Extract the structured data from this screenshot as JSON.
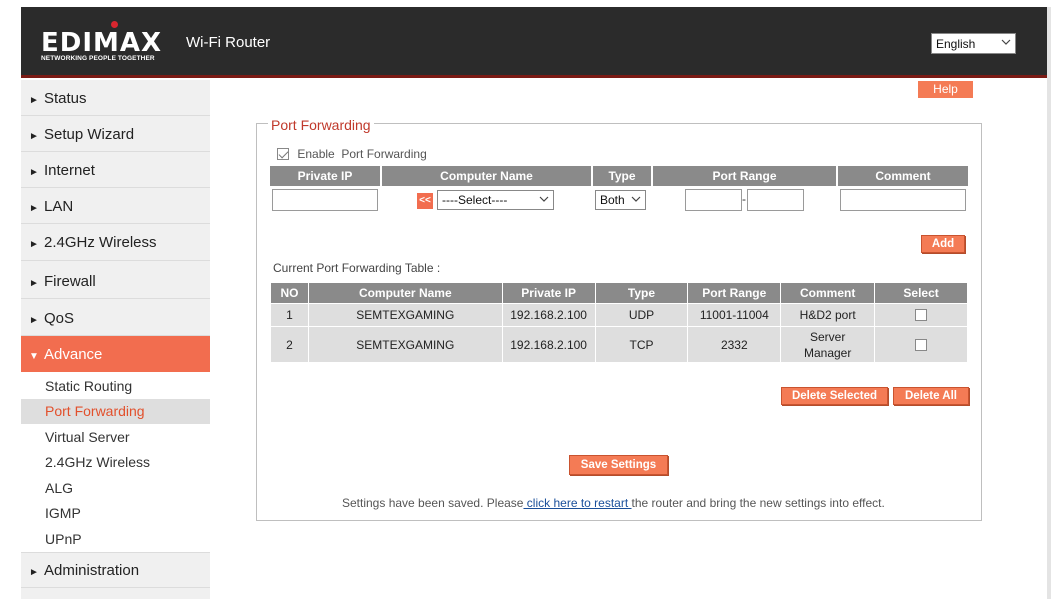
{
  "header": {
    "logo_text": "EDIMAX",
    "logo_tagline": "NETWORKING PEOPLE TOGETHER",
    "app_title": "Wi-Fi Router",
    "language": "English"
  },
  "sidebar": {
    "items": [
      {
        "label": "Status"
      },
      {
        "label": "Setup Wizard"
      },
      {
        "label": "Internet"
      },
      {
        "label": "LAN"
      },
      {
        "label": "2.4GHz Wireless"
      },
      {
        "label": "Firewall"
      },
      {
        "label": "QoS"
      },
      {
        "label": "Advance"
      },
      {
        "label": "Administration"
      }
    ],
    "advance_sub": [
      {
        "label": "Static Routing"
      },
      {
        "label": "Port Forwarding"
      },
      {
        "label": "Virtual Server"
      },
      {
        "label": "2.4GHz Wireless"
      },
      {
        "label": "ALG"
      },
      {
        "label": "IGMP"
      },
      {
        "label": "UPnP"
      }
    ]
  },
  "main": {
    "help_label": "Help",
    "section_title": "Port Forwarding",
    "enable_label": "Enable  Port Forwarding",
    "enable_checked": true,
    "form_headers": [
      "Private IP",
      "Computer Name",
      "Type",
      "Port Range",
      "Comment"
    ],
    "form": {
      "private_ip": "",
      "arrow_label": "<<",
      "computer_select": "----Select----",
      "type_select": "Both",
      "port_from": "",
      "port_sep": "-",
      "port_to": "",
      "comment": ""
    },
    "add_label": "Add",
    "table_caption": "Current Port Forwarding Table :",
    "table_headers": [
      "NO",
      "Computer Name",
      "Private IP",
      "Type",
      "Port Range",
      "Comment",
      "Select"
    ],
    "rows": [
      {
        "no": "1",
        "computer": "SEMTEXGAMING",
        "ip": "192.168.2.100",
        "type": "UDP",
        "range": "11001-11004",
        "comment": "H&D2 port",
        "selected": false
      },
      {
        "no": "2",
        "computer": "SEMTEXGAMING",
        "ip": "192.168.2.100",
        "type": "TCP",
        "range": "2332",
        "comment": "Server Manager",
        "selected": false
      }
    ],
    "delete_selected_label": "Delete Selected",
    "delete_all_label": "Delete All",
    "save_label": "Save Settings",
    "footer_before": "Settings have been saved. Please",
    "footer_link": " click here to restart ",
    "footer_after": "the router and bring the new settings into effect."
  },
  "colors": {
    "accent": "#f26d4f",
    "header_bg": "#2b2b2b",
    "table_header": "#8a8a8a",
    "title_red": "#c0392b"
  }
}
